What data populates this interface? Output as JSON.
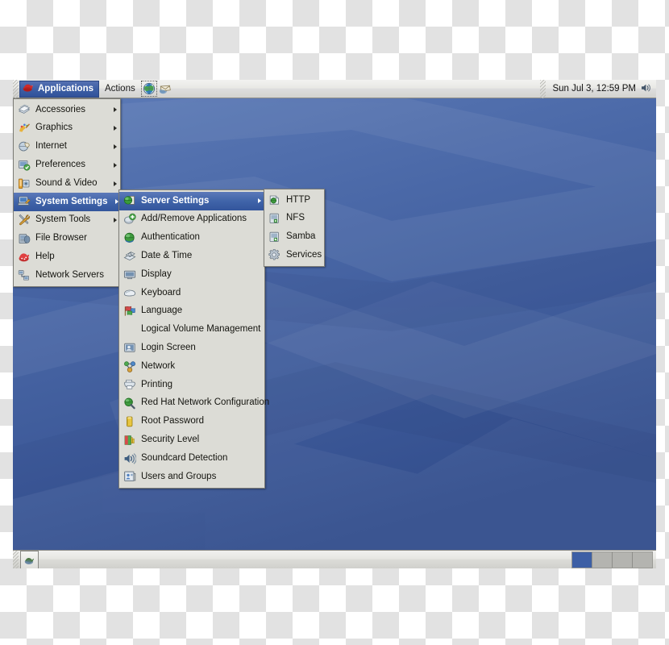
{
  "desktop": {
    "wallpaper_name": "bluecurve-waves",
    "colors": {
      "wallpaper_top": "#5878b4",
      "wallpaper_bottom": "#35508f",
      "panel_face": "#e6e6e2",
      "menu_face": "#dcdcd6",
      "selection_blue": "#3d5fa5",
      "selection_text": "#ffffff"
    }
  },
  "top_panel": {
    "applications_label": "Applications",
    "applications_icon": "redhat-shadowman-icon",
    "actions_label": "Actions",
    "launchers": [
      {
        "name": "web-browser-icon",
        "label": "Web Browser",
        "selected": true
      },
      {
        "name": "email-client-icon",
        "label": "Email",
        "selected": false
      }
    ],
    "clock": "Sun Jul  3, 12:59 PM",
    "volume_icon": "speaker-icon"
  },
  "bottom_panel": {
    "show_desktop_icon": "show-desktop-icon",
    "window_list_items": [],
    "workspaces": [
      {
        "label": "Workspace 1",
        "active": true
      },
      {
        "label": "Workspace 2",
        "active": false
      },
      {
        "label": "Workspace 3",
        "active": false
      },
      {
        "label": "Workspace 4",
        "active": false
      }
    ]
  },
  "applications_menu": {
    "items": [
      {
        "label": "Accessories",
        "icon": "accessories-icon",
        "submenu": true,
        "selected": false
      },
      {
        "label": "Graphics",
        "icon": "graphics-icon",
        "submenu": true,
        "selected": false
      },
      {
        "label": "Internet",
        "icon": "internet-icon",
        "submenu": true,
        "selected": false
      },
      {
        "label": "Preferences",
        "icon": "preferences-icon",
        "submenu": true,
        "selected": false
      },
      {
        "label": "Sound & Video",
        "icon": "sound-video-icon",
        "submenu": true,
        "selected": false
      },
      {
        "label": "System Settings",
        "icon": "system-settings-icon",
        "submenu": true,
        "selected": true
      },
      {
        "label": "System Tools",
        "icon": "system-tools-icon",
        "submenu": true,
        "selected": false
      },
      {
        "label": "File Browser",
        "icon": "file-browser-icon",
        "submenu": false,
        "selected": false
      },
      {
        "label": "Help",
        "icon": "help-icon",
        "submenu": false,
        "selected": false
      },
      {
        "label": "Network Servers",
        "icon": "network-servers-icon",
        "submenu": false,
        "selected": false
      }
    ]
  },
  "system_settings_menu": {
    "items": [
      {
        "label": "Server Settings",
        "icon": "server-settings-icon",
        "submenu": true,
        "selected": true
      },
      {
        "label": "Add/Remove Applications",
        "icon": "add-remove-icon",
        "submenu": false,
        "selected": false
      },
      {
        "label": "Authentication",
        "icon": "authentication-icon",
        "submenu": false,
        "selected": false
      },
      {
        "label": "Date & Time",
        "icon": "date-time-icon",
        "submenu": false,
        "selected": false
      },
      {
        "label": "Display",
        "icon": "display-icon",
        "submenu": false,
        "selected": false
      },
      {
        "label": "Keyboard",
        "icon": "keyboard-icon",
        "submenu": false,
        "selected": false
      },
      {
        "label": "Language",
        "icon": "language-icon",
        "submenu": false,
        "selected": false
      },
      {
        "label": "Logical Volume Management",
        "icon": "none",
        "submenu": false,
        "selected": false
      },
      {
        "label": "Login Screen",
        "icon": "login-screen-icon",
        "submenu": false,
        "selected": false
      },
      {
        "label": "Network",
        "icon": "network-icon",
        "submenu": false,
        "selected": false
      },
      {
        "label": "Printing",
        "icon": "printing-icon",
        "submenu": false,
        "selected": false
      },
      {
        "label": "Red Hat Network Configuration",
        "icon": "rhn-config-icon",
        "submenu": false,
        "selected": false
      },
      {
        "label": "Root Password",
        "icon": "root-password-icon",
        "submenu": false,
        "selected": false
      },
      {
        "label": "Security Level",
        "icon": "security-level-icon",
        "submenu": false,
        "selected": false
      },
      {
        "label": "Soundcard Detection",
        "icon": "soundcard-icon",
        "submenu": false,
        "selected": false
      },
      {
        "label": "Users and Groups",
        "icon": "users-groups-icon",
        "submenu": false,
        "selected": false
      }
    ]
  },
  "server_settings_menu": {
    "items": [
      {
        "label": "HTTP",
        "icon": "http-icon",
        "submenu": false,
        "selected": false
      },
      {
        "label": "NFS",
        "icon": "nfs-icon",
        "submenu": false,
        "selected": false
      },
      {
        "label": "Samba",
        "icon": "samba-icon",
        "submenu": false,
        "selected": false
      },
      {
        "label": "Services",
        "icon": "services-icon",
        "submenu": false,
        "selected": false
      }
    ]
  }
}
